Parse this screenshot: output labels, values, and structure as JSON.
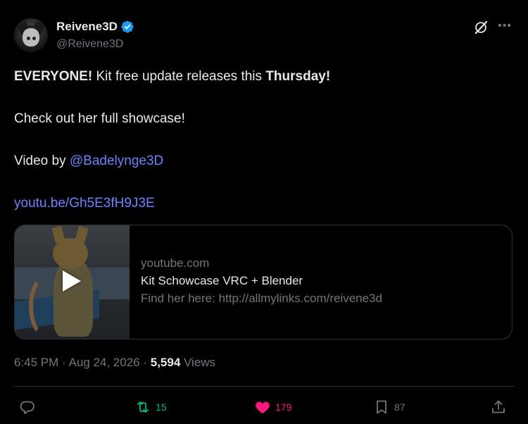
{
  "author": {
    "display_name": "Reivene3D",
    "handle": "@Reivene3D",
    "verified": true,
    "avatar_icon": "avatar-cat-icon"
  },
  "post": {
    "line1_strong_a": "EVERYONE!",
    "line1_mid": " Kit free update releases this ",
    "line1_strong_b": "Thursday!",
    "line2": "Check out her full showcase!",
    "line3_prefix": "Video by ",
    "line3_mention": "@Badelynge3D",
    "line4_link": "youtu.be/Gh5E3fH9J3E"
  },
  "card": {
    "domain": "youtube.com",
    "title": "Kit Schowcase VRC + Blender",
    "description": "Find her here: http://allmylinks.com/reivene3d",
    "thumbnail_icon": "video-thumbnail",
    "play_icon": "play-icon"
  },
  "meta": {
    "timestamp": "6:45 PM · Aug 24, 2026 · ",
    "views_count": "5,594",
    "views_label": " Views"
  },
  "actions": {
    "reply_count": "",
    "retweet_count": "15",
    "like_count": "179",
    "bookmark_count": "87"
  },
  "colors": {
    "background": "#000000",
    "text": "#e7e9ea",
    "muted": "#71767b",
    "link": "#6e84f6",
    "retweet": "#00ba7c",
    "like": "#f91880",
    "verified": "#1d9bf0"
  }
}
